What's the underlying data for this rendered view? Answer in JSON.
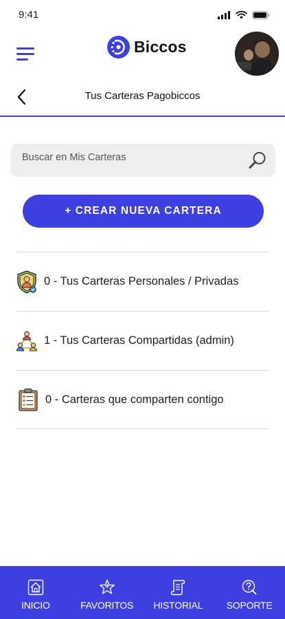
{
  "status_bar": {
    "time": "9:41",
    "icons": [
      "signal-icon",
      "wifi-icon",
      "battery-icon"
    ]
  },
  "header": {
    "brand": "Biccos",
    "menu_icon": "hamburger-menu-icon",
    "avatar": "user-avatar"
  },
  "title_bar": {
    "title": "Tus Carteras Pagobiccos",
    "back_icon": "chevron-left-icon"
  },
  "search": {
    "placeholder": "Buscar en Mis Carteras",
    "value": "",
    "icon": "search-icon"
  },
  "create_button": {
    "label": "+ CREAR NUEVA CARTERA"
  },
  "wallets": [
    {
      "label": "0 - Tus Carteras Personales / Privadas",
      "icon": "personal-shield-icon"
    },
    {
      "label": "1 - Tus Carteras Compartidas (admin)",
      "icon": "shared-group-icon"
    },
    {
      "label": "0 - Carteras que comparten contigo",
      "icon": "clipboard-list-icon"
    }
  ],
  "bottom_nav": [
    {
      "label": "INICIO",
      "icon": "home-icon"
    },
    {
      "label": "FAVORITOS",
      "icon": "star-icon"
    },
    {
      "label": "HISTORIAL",
      "icon": "scroll-icon"
    },
    {
      "label": "SOPORTE",
      "icon": "support-icon"
    }
  ],
  "colors": {
    "accent": "#3d3fe0",
    "background": "#ffffff",
    "search_bg": "#eeeeee",
    "divider": "#d8d8d8"
  }
}
